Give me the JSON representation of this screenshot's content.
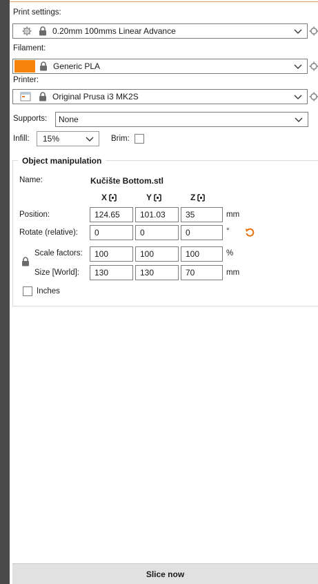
{
  "print_settings": {
    "label": "Print settings:",
    "value": "0.20mm 100mms Linear Advance"
  },
  "filament": {
    "label": "Filament:",
    "value": "Generic PLA",
    "color": "#f7820c"
  },
  "printer": {
    "label": "Printer:",
    "value": "Original Prusa i3 MK2S"
  },
  "supports": {
    "label": "Supports:",
    "value": "None"
  },
  "infill": {
    "label": "Infill:",
    "value": "15%"
  },
  "brim": {
    "label": "Brim:",
    "checked": false
  },
  "object_manipulation": {
    "title": "Object manipulation",
    "name_label": "Name:",
    "name_value": "Kučište Bottom.stl",
    "axes": [
      "X",
      "Y",
      "Z"
    ],
    "rows": {
      "position": {
        "label": "Position:",
        "x": "124.65",
        "y": "101.03",
        "z": "35",
        "unit": "mm"
      },
      "rotate": {
        "label": "Rotate (relative):",
        "x": "0",
        "y": "0",
        "z": "0",
        "unit": "°"
      },
      "scale": {
        "label": "Scale factors:",
        "x": "100",
        "y": "100",
        "z": "100",
        "unit": "%"
      },
      "size": {
        "label": "Size [World]:",
        "x": "130",
        "y": "130",
        "z": "70",
        "unit": "mm"
      }
    },
    "inches_label": "Inches",
    "inches_checked": false
  },
  "slice_button": "Slice now",
  "colors": {
    "accent_orange": "#f7820c",
    "reset_arrow": "#e8720c"
  },
  "icons": [
    "gear-icon",
    "lock-icon",
    "chevron-down-icon",
    "printer-icon",
    "axis-drag-icon",
    "undo-icon"
  ]
}
